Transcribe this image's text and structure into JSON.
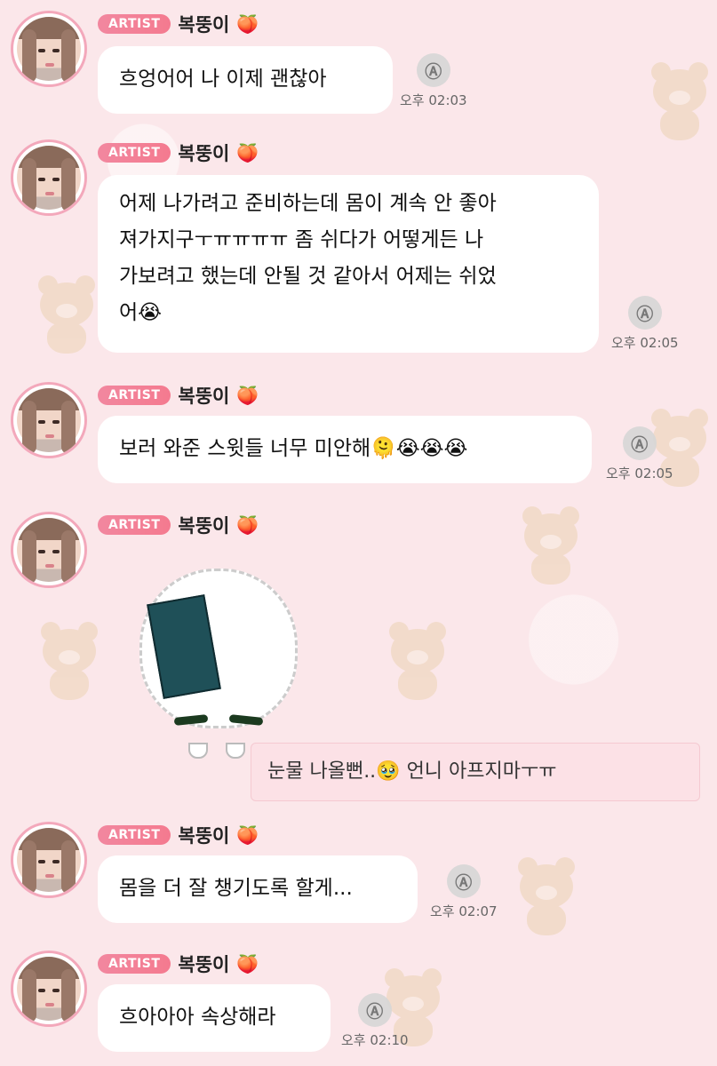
{
  "badge": "ARTIST",
  "sender": {
    "name": "복뚱이",
    "emoji": "🍑"
  },
  "translate_icon": "Ⓐ",
  "messages": [
    {
      "text": "흐엉어어 나 이제 괜찮아",
      "time": "오후 02:03"
    },
    {
      "text": "어제 나가려고 준비하는데 몸이 계속 안 좋아\n져가지구ㅜㅠㅠㅠㅠ 좀 쉬다가 어떻게든 나\n가보려고 했는데 안될 것 같아서 어제는 쉬었\n어😭",
      "time": "오후 02:05"
    },
    {
      "text": "보러 와준 스윗들 너무 미안해🫠😭😭😭",
      "time": "오후 02:05"
    },
    {
      "text": "몸을 더 잘 챙기도록 할게...",
      "time": "오후 02:07"
    },
    {
      "text": "흐아아아 속상해라",
      "time": "오후 02:10"
    }
  ],
  "reply_bubble": {
    "text": "눈물 나올뻔..🥹 언니 아프지마ㅜㅠ"
  },
  "sticker": {
    "icon": "onigiri-sticker"
  }
}
